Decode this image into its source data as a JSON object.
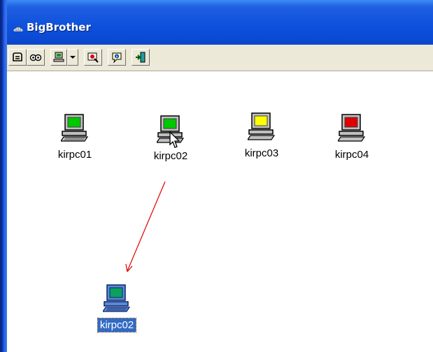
{
  "window": {
    "title": "BigBrother"
  },
  "toolbar": {
    "buttons": [
      {
        "icon": "open-icon"
      },
      {
        "icon": "watch-icon"
      },
      {
        "icon": "add-host-icon"
      },
      {
        "icon": "dropdown-arrow-icon"
      },
      {
        "icon": "monitor-icon"
      },
      {
        "icon": "info-icon"
      },
      {
        "icon": "exit-icon"
      }
    ]
  },
  "hosts": [
    {
      "label": "kirpc01",
      "status_color": "#00c800"
    },
    {
      "label": "kirpc02",
      "status_color": "#00c800"
    },
    {
      "label": "kirpc03",
      "status_color": "#ffff00"
    },
    {
      "label": "kirpc04",
      "status_color": "#e00000"
    }
  ],
  "dragged_host": {
    "label": "kirpc02",
    "status_color": "#00c800"
  },
  "colors": {
    "titlebar": "#0b4fdc",
    "toolbar_bg": "#ece9d8",
    "selection": "#316ac5",
    "drag_arrow": "#e00000"
  }
}
